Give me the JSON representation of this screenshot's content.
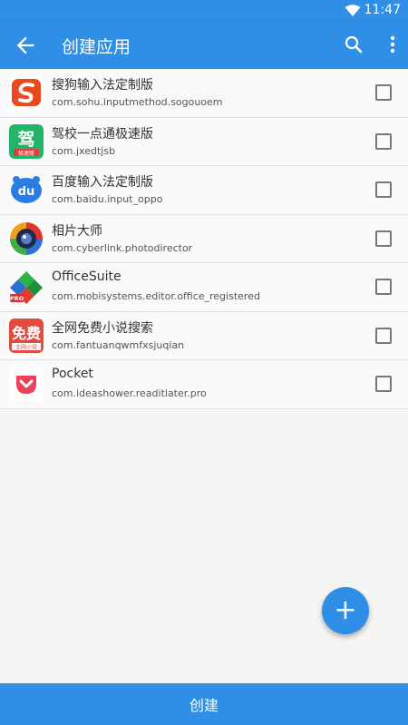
{
  "status_bar": {
    "time": "11:47",
    "wifi_icon": "wifi-icon"
  },
  "app_bar": {
    "title": "创建应用",
    "back_icon": "arrow-back-icon",
    "search_icon": "search-icon",
    "more_icon": "more-vert-icon"
  },
  "apps": [
    {
      "name": "搜狗输入法定制版",
      "package": "com.sohu.inputmethod.sogouoem",
      "icon": "sogou-icon",
      "checked": false
    },
    {
      "name": "驾校一点通极速版",
      "package": "com.jxedtjsb",
      "icon": "jiaxiao-icon",
      "checked": false
    },
    {
      "name": "百度输入法定制版",
      "package": "com.baidu.input_oppo",
      "icon": "baidu-input-icon",
      "checked": false
    },
    {
      "name": "相片大师",
      "package": "com.cyberlink.photodirector",
      "icon": "photodirector-icon",
      "checked": false
    },
    {
      "name": "OfficeSuite",
      "package": "com.mobisystems.editor.office_registered",
      "icon": "officesuite-icon",
      "checked": false
    },
    {
      "name": "全网免费小说搜索",
      "package": "com.fantuanqwmfxsjuqian",
      "icon": "mianfei-xiaoshuo-icon",
      "checked": false
    },
    {
      "name": "Pocket",
      "package": "com.ideashower.readitlater.pro",
      "icon": "pocket-icon",
      "checked": false
    }
  ],
  "fab": {
    "label": "+",
    "icon": "add-icon"
  },
  "bottom_button": {
    "label": "创建"
  },
  "colors": {
    "primary": "#2f8ee6"
  }
}
